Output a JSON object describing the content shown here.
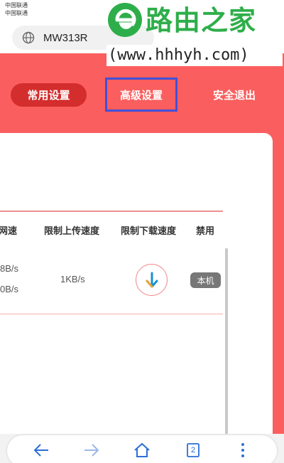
{
  "status_bar": {
    "carrier1": "中国联通",
    "carrier2": "中国联通"
  },
  "address_bar": {
    "url": "MW313R"
  },
  "watermark": {
    "title": "路由之家",
    "url": "(www.hhhyh.com)"
  },
  "nav": {
    "tabs": [
      {
        "label": "常用设置",
        "active": true
      },
      {
        "label": "高级设置",
        "highlighted": true
      },
      {
        "label": "安全退出"
      }
    ]
  },
  "table": {
    "headers": [
      "网速",
      "限制上传速度",
      "限制下载速度",
      "禁用"
    ],
    "rows": [
      {
        "speed_up": "8B/s",
        "speed_down": "0B/s",
        "upload_limit": "1KB/s",
        "device_badge": "本机"
      }
    ]
  },
  "bottom_bar": {
    "tab_count": "2"
  },
  "colors": {
    "accent": "#fb5e5e",
    "tab_active": "#d42d2d",
    "highlight_border": "#4450d6",
    "download_arrow": "#1a8fd6",
    "watermark_green": "#2eae4a"
  },
  "icons": [
    "globe-icon",
    "download-arrow-icon",
    "back-icon",
    "forward-icon",
    "home-icon",
    "tabs-icon",
    "more-icon"
  ]
}
